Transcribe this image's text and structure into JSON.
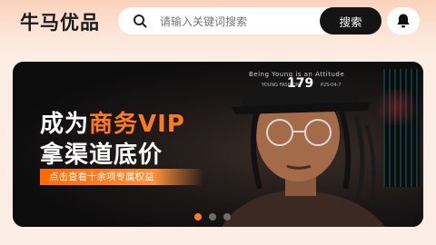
{
  "header": {
    "logo": "牛马优品",
    "search": {
      "placeholder": "请输入关键词搜索",
      "button_label": "搜索"
    }
  },
  "banner": {
    "headline_line1_prefix": "成为",
    "headline_line1_accent": "商务VIP",
    "headline_line2": "拿渠道底价",
    "cta": "点击查看十余项专属权益",
    "overlay": {
      "caption": "Being Young is an Attitude",
      "number": "179",
      "small_left": "YOUNG FASHION",
      "small_right": "P2S-04-7"
    },
    "carousel": {
      "count": 3,
      "active_index": 0
    }
  },
  "colors": {
    "accent": "#ff7a1a",
    "button_dark": "#141414",
    "header_bg": "#fbd3bd"
  },
  "icons": [
    "search-icon",
    "bell-icon"
  ]
}
